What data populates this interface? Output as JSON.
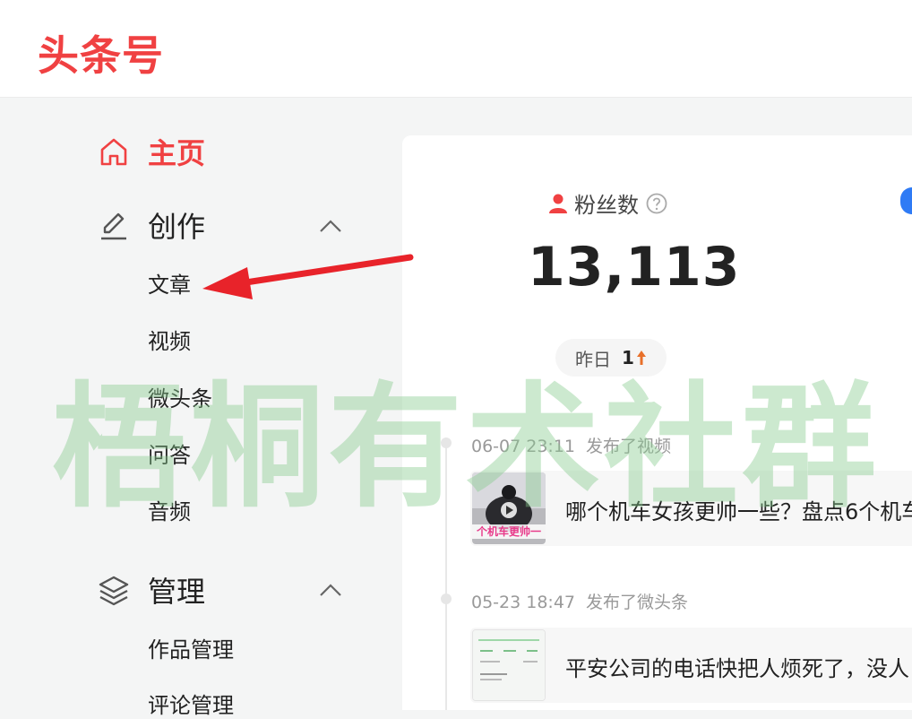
{
  "brand": {
    "logo_text": "头条号",
    "accent_color": "#f04142"
  },
  "sidebar": {
    "home": {
      "label": "主页",
      "icon": "home-icon"
    },
    "create": {
      "label": "创作",
      "icon": "pencil-icon",
      "items": [
        "文章",
        "视频",
        "微头条",
        "问答",
        "音频"
      ]
    },
    "manage": {
      "label": "管理",
      "icon": "layers-icon",
      "items": [
        "作品管理",
        "评论管理"
      ]
    }
  },
  "stats": {
    "followers_label": "粉丝数",
    "followers_value": "13,113",
    "yesterday_label": "昨日",
    "yesterday_value": "1"
  },
  "timeline": [
    {
      "date": "06-07 23:11",
      "action": "发布了视频",
      "title": "哪个机车女孩更帅一些？盘点6个机车",
      "thumb_caption": "个机车更帅一"
    },
    {
      "date": "05-23 18:47",
      "action": "发布了微头条",
      "title": "平安公司的电话快把人烦死了，没人"
    }
  ],
  "watermark": {
    "text": "梧桐有术社群",
    "color": "#86ca8c"
  },
  "annotation": {
    "arrow_color": "#e8232a"
  }
}
